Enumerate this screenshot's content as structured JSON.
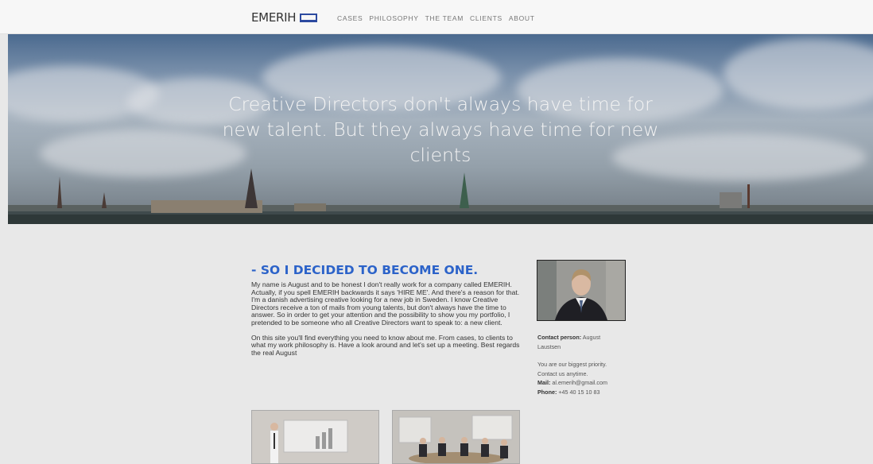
{
  "nav": {
    "logo_text": "EMERIH",
    "items": [
      "CASES",
      "PHILOSOPHY",
      "THE TEAM",
      "CLIENTS",
      "ABOUT"
    ]
  },
  "hero": {
    "title": "Creative Directors don't always have time for new talent. But they always have time for new clients"
  },
  "main": {
    "headline": "- SO I DECIDED TO BECOME ONE.",
    "paragraphs": [
      "My name is August and to be honest I don't really work for a company called EMERIH. Actually, if you spell EMERIH backwards it says 'HIRE ME'. And there's a reason for that. I'm a danish advertising creative looking for a new job in Sweden. I know Creative Directors receive a ton of mails from young talents, but don't always have the time to answer. So in order to get your attention and the possibility to show you my portfolio, I pretended to be someone who all Creative Directors want to speak to: a new client.",
      "On this site you'll find everything you need to know about me. From cases, to clients to what my work philosophy is. Have a look around and let's set up a meeting. Best regards the real August"
    ]
  },
  "contact": {
    "label": "Contact person:",
    "name": "August Laustsen",
    "priority_1": "You are our biggest priority.",
    "priority_2": "Contact us anytime.",
    "mail_label": "Mail:",
    "mail_value": "al.emerih@gmail.com",
    "phone_label": "Phone:",
    "phone_value": "+45 40 15 10 83"
  },
  "colors": {
    "accent": "#2c63c9",
    "logo_blue": "#2c4aa0",
    "nav_bg": "#f7f7f7",
    "body_bg": "#e8e8e8"
  }
}
